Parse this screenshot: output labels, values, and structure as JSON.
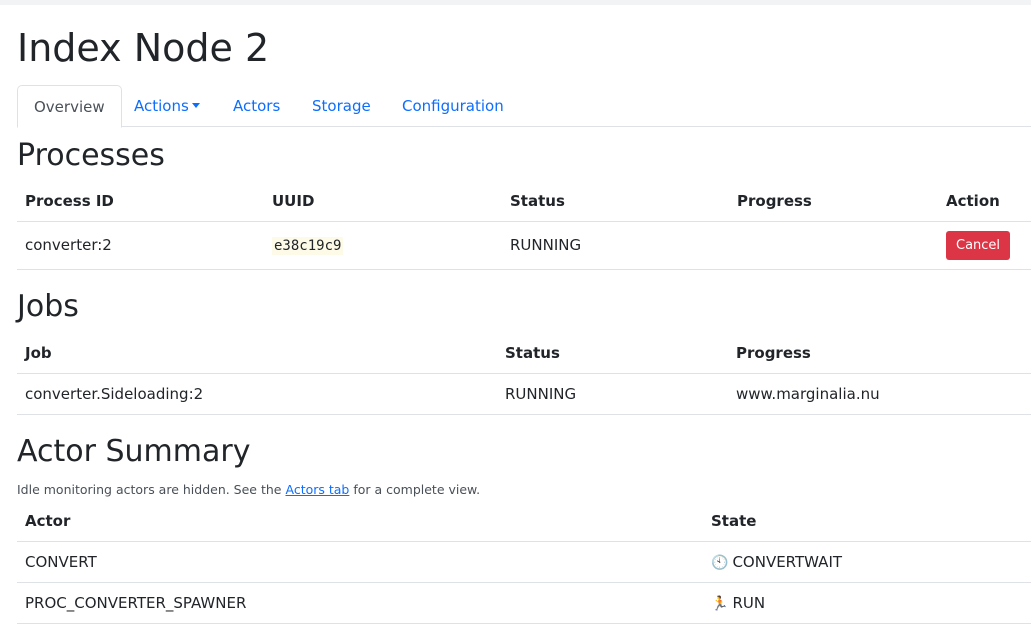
{
  "page": {
    "title": "Index Node 2"
  },
  "tabs": [
    {
      "label": "Overview",
      "active": true
    },
    {
      "label": "Actions",
      "dropdown": true
    },
    {
      "label": "Actors"
    },
    {
      "label": "Storage"
    },
    {
      "label": "Configuration"
    }
  ],
  "processes": {
    "heading": "Processes",
    "columns": [
      "Process ID",
      "UUID",
      "Status",
      "Progress",
      "Action"
    ],
    "rows": [
      {
        "process_id": "converter:2",
        "uuid": "e38c19c9",
        "status": "RUNNING",
        "progress": "",
        "action": "Cancel"
      }
    ]
  },
  "jobs": {
    "heading": "Jobs",
    "columns": [
      "Job",
      "Status",
      "Progress"
    ],
    "rows": [
      {
        "job": "converter.Sideloading:2",
        "status": "RUNNING",
        "progress": "www.marginalia.nu"
      }
    ]
  },
  "actors": {
    "heading": "Actor Summary",
    "note_prefix": "Idle monitoring actors are hidden. See the",
    "note_link": "Actors tab",
    "note_suffix": "for a complete view.",
    "columns": [
      "Actor",
      "State"
    ],
    "rows": [
      {
        "actor": "CONVERT",
        "state_icon": "🕙",
        "state_icon_name": "clock-icon",
        "state": "CONVERTWAIT"
      },
      {
        "actor": "PROC_CONVERTER_SPAWNER",
        "state_icon": "🏃",
        "state_icon_name": "running-person-icon",
        "state": "RUN"
      }
    ]
  },
  "colors": {
    "link": "#0d6efd",
    "danger": "#dc3545",
    "border": "#dee2e6"
  }
}
